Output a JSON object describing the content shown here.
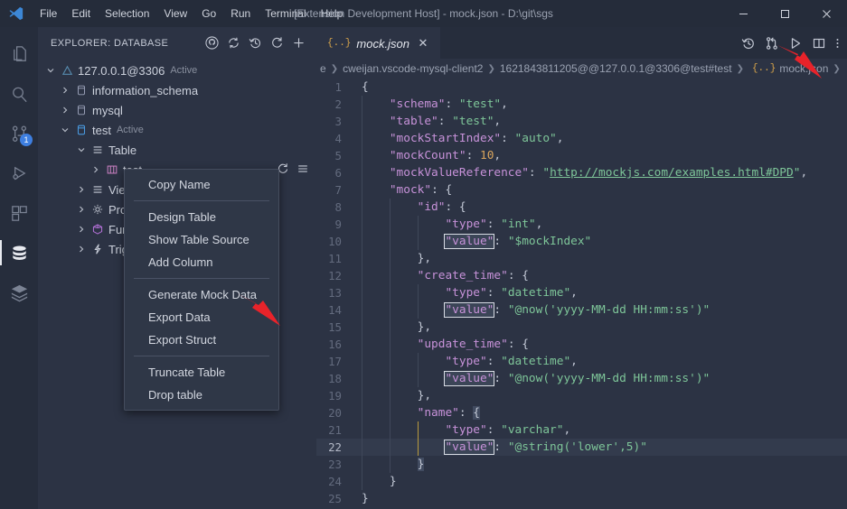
{
  "window": {
    "title": "[Extension Development Host] - mock.json - D:\\git\\sgs",
    "minimize": "—",
    "maximize": "☐",
    "close": "✕"
  },
  "menu": {
    "items": [
      {
        "label": "File"
      },
      {
        "label": "Edit"
      },
      {
        "label": "Selection"
      },
      {
        "label": "View"
      },
      {
        "label": "Go"
      },
      {
        "label": "Run"
      },
      {
        "label": "Terminal"
      },
      {
        "label": "Help"
      }
    ]
  },
  "activitybar": {
    "items": [
      {
        "name": "explorer-files-icon",
        "badge": ""
      },
      {
        "name": "search-icon",
        "badge": ""
      },
      {
        "name": "source-control-icon",
        "badge": "1"
      },
      {
        "name": "run-debug-icon",
        "badge": ""
      },
      {
        "name": "extensions-icon",
        "badge": ""
      },
      {
        "name": "database-icon",
        "badge": ""
      },
      {
        "name": "database-stack-icon",
        "badge": ""
      }
    ]
  },
  "sidebar": {
    "title": "EXPLORER: DATABASE",
    "actions": [
      {
        "name": "github-icon"
      },
      {
        "name": "sync-icon"
      },
      {
        "name": "history-icon"
      },
      {
        "name": "refresh-icon"
      },
      {
        "name": "add-icon"
      }
    ],
    "tree": [
      {
        "label": "127.0.0.1@3306",
        "sub": "Active",
        "icon": "server-icon",
        "indent": 0,
        "expanded": true
      },
      {
        "label": "information_schema",
        "sub": "",
        "icon": "database-icon",
        "indent": 1,
        "expanded": false
      },
      {
        "label": "mysql",
        "sub": "",
        "icon": "database-icon",
        "indent": 1,
        "expanded": false
      },
      {
        "label": "test",
        "sub": "Active",
        "icon": "database-active-icon",
        "indent": 1,
        "expanded": true
      },
      {
        "label": "Table",
        "sub": "",
        "icon": "table-group-icon",
        "indent": 2,
        "expanded": true
      },
      {
        "label": "test",
        "sub": "",
        "icon": "table-icon",
        "indent": 3,
        "expanded": false
      },
      {
        "label": "View",
        "sub": "",
        "icon": "view-group-icon",
        "indent": 2,
        "expanded": false
      },
      {
        "label": "Proc",
        "sub": "",
        "icon": "procedure-icon",
        "indent": 2,
        "expanded": false
      },
      {
        "label": "Func",
        "sub": "",
        "icon": "function-icon",
        "indent": 2,
        "expanded": false
      },
      {
        "label": "Trigg",
        "sub": "",
        "icon": "trigger-icon",
        "indent": 2,
        "expanded": false
      }
    ],
    "row_actions": [
      {
        "name": "refresh-icon"
      },
      {
        "name": "menu-icon"
      }
    ]
  },
  "context_menu": {
    "items": [
      {
        "label": "Copy Name",
        "type": "item"
      },
      {
        "label": "",
        "type": "separator"
      },
      {
        "label": "Design Table",
        "type": "item"
      },
      {
        "label": "Show Table Source",
        "type": "item"
      },
      {
        "label": "Add Column",
        "type": "item"
      },
      {
        "label": "",
        "type": "separator"
      },
      {
        "label": "Generate Mock Data",
        "type": "item"
      },
      {
        "label": "Export Data",
        "type": "item"
      },
      {
        "label": "Export Struct",
        "type": "item"
      },
      {
        "label": "",
        "type": "separator"
      },
      {
        "label": "Truncate Table",
        "type": "item"
      },
      {
        "label": "Drop table",
        "type": "item"
      }
    ]
  },
  "editor": {
    "tab": {
      "label": "mock.json",
      "glyph": "{..}",
      "close": "✕"
    },
    "actions": [
      {
        "name": "timeline-history-icon"
      },
      {
        "name": "compare-changes-icon"
      },
      {
        "name": "run-play-icon"
      },
      {
        "name": "split-editor-icon"
      },
      {
        "name": "more-actions-icon"
      }
    ],
    "breadcrumb": [
      "e",
      "cweijan.vscode-mysql-client2",
      "1621843811205@@127.0.0.1@3306@test#test",
      "mock.json",
      ""
    ],
    "active_line": 22,
    "lines": [
      {
        "n": 1,
        "tokens": [
          {
            "t": "p",
            "v": "{"
          }
        ]
      },
      {
        "n": 2,
        "tokens": [
          {
            "t": "sp",
            "v": "    "
          },
          {
            "t": "k",
            "v": "\"schema\""
          },
          {
            "t": "p",
            "v": ": "
          },
          {
            "t": "s",
            "v": "\"test\""
          },
          {
            "t": "p",
            "v": ","
          }
        ]
      },
      {
        "n": 3,
        "tokens": [
          {
            "t": "sp",
            "v": "    "
          },
          {
            "t": "k",
            "v": "\"table\""
          },
          {
            "t": "p",
            "v": ": "
          },
          {
            "t": "s",
            "v": "\"test\""
          },
          {
            "t": "p",
            "v": ","
          }
        ]
      },
      {
        "n": 4,
        "tokens": [
          {
            "t": "sp",
            "v": "    "
          },
          {
            "t": "k",
            "v": "\"mockStartIndex\""
          },
          {
            "t": "p",
            "v": ": "
          },
          {
            "t": "s",
            "v": "\"auto\""
          },
          {
            "t": "p",
            "v": ","
          }
        ]
      },
      {
        "n": 5,
        "tokens": [
          {
            "t": "sp",
            "v": "    "
          },
          {
            "t": "k",
            "v": "\"mockCount\""
          },
          {
            "t": "p",
            "v": ": "
          },
          {
            "t": "n",
            "v": "10"
          },
          {
            "t": "p",
            "v": ","
          }
        ]
      },
      {
        "n": 6,
        "tokens": [
          {
            "t": "sp",
            "v": "    "
          },
          {
            "t": "k",
            "v": "\"mockValueReference\""
          },
          {
            "t": "p",
            "v": ": "
          },
          {
            "t": "s",
            "v": "\""
          },
          {
            "t": "url",
            "v": "http://mockjs.com/examples.html#DPD"
          },
          {
            "t": "s",
            "v": "\""
          },
          {
            "t": "p",
            "v": ","
          }
        ]
      },
      {
        "n": 7,
        "tokens": [
          {
            "t": "sp",
            "v": "    "
          },
          {
            "t": "k",
            "v": "\"mock\""
          },
          {
            "t": "p",
            "v": ": {"
          }
        ]
      },
      {
        "n": 8,
        "tokens": [
          {
            "t": "sp",
            "v": "        "
          },
          {
            "t": "k",
            "v": "\"id\""
          },
          {
            "t": "p",
            "v": ": {"
          }
        ]
      },
      {
        "n": 9,
        "tokens": [
          {
            "t": "sp",
            "v": "            "
          },
          {
            "t": "k",
            "v": "\"type\""
          },
          {
            "t": "p",
            "v": ": "
          },
          {
            "t": "s",
            "v": "\"int\""
          },
          {
            "t": "p",
            "v": ","
          }
        ]
      },
      {
        "n": 10,
        "tokens": [
          {
            "t": "sp",
            "v": "            "
          },
          {
            "t": "km",
            "v": "\"value\""
          },
          {
            "t": "p",
            "v": ": "
          },
          {
            "t": "s",
            "v": "\"$mockIndex\""
          }
        ]
      },
      {
        "n": 11,
        "tokens": [
          {
            "t": "sp",
            "v": "        "
          },
          {
            "t": "p",
            "v": "},"
          }
        ]
      },
      {
        "n": 12,
        "tokens": [
          {
            "t": "sp",
            "v": "        "
          },
          {
            "t": "k",
            "v": "\"create_time\""
          },
          {
            "t": "p",
            "v": ": {"
          }
        ]
      },
      {
        "n": 13,
        "tokens": [
          {
            "t": "sp",
            "v": "            "
          },
          {
            "t": "k",
            "v": "\"type\""
          },
          {
            "t": "p",
            "v": ": "
          },
          {
            "t": "s",
            "v": "\"datetime\""
          },
          {
            "t": "p",
            "v": ","
          }
        ]
      },
      {
        "n": 14,
        "tokens": [
          {
            "t": "sp",
            "v": "            "
          },
          {
            "t": "km",
            "v": "\"value\""
          },
          {
            "t": "p",
            "v": ": "
          },
          {
            "t": "s",
            "v": "\"@now('yyyy-MM-dd HH:mm:ss')\""
          }
        ]
      },
      {
        "n": 15,
        "tokens": [
          {
            "t": "sp",
            "v": "        "
          },
          {
            "t": "p",
            "v": "},"
          }
        ]
      },
      {
        "n": 16,
        "tokens": [
          {
            "t": "sp",
            "v": "        "
          },
          {
            "t": "k",
            "v": "\"update_time\""
          },
          {
            "t": "p",
            "v": ": {"
          }
        ]
      },
      {
        "n": 17,
        "tokens": [
          {
            "t": "sp",
            "v": "            "
          },
          {
            "t": "k",
            "v": "\"type\""
          },
          {
            "t": "p",
            "v": ": "
          },
          {
            "t": "s",
            "v": "\"datetime\""
          },
          {
            "t": "p",
            "v": ","
          }
        ]
      },
      {
        "n": 18,
        "tokens": [
          {
            "t": "sp",
            "v": "            "
          },
          {
            "t": "km",
            "v": "\"value\""
          },
          {
            "t": "p",
            "v": ": "
          },
          {
            "t": "s",
            "v": "\"@now('yyyy-MM-dd HH:mm:ss')\""
          }
        ]
      },
      {
        "n": 19,
        "tokens": [
          {
            "t": "sp",
            "v": "        "
          },
          {
            "t": "p",
            "v": "},"
          }
        ]
      },
      {
        "n": 20,
        "tokens": [
          {
            "t": "sp",
            "v": "        "
          },
          {
            "t": "k",
            "v": "\"name\""
          },
          {
            "t": "p",
            "v": ": "
          },
          {
            "t": "br",
            "v": "{"
          }
        ]
      },
      {
        "n": 21,
        "tokens": [
          {
            "t": "sp",
            "v": "            "
          },
          {
            "t": "k",
            "v": "\"type\""
          },
          {
            "t": "p",
            "v": ": "
          },
          {
            "t": "s",
            "v": "\"varchar\""
          },
          {
            "t": "p",
            "v": ","
          }
        ]
      },
      {
        "n": 22,
        "tokens": [
          {
            "t": "sp",
            "v": "            "
          },
          {
            "t": "km",
            "v": "\"value\""
          },
          {
            "t": "p",
            "v": ": "
          },
          {
            "t": "s",
            "v": "\"@string('lower',5)\""
          }
        ]
      },
      {
        "n": 23,
        "tokens": [
          {
            "t": "sp",
            "v": "        "
          },
          {
            "t": "br",
            "v": "}"
          }
        ]
      },
      {
        "n": 24,
        "tokens": [
          {
            "t": "sp",
            "v": "    "
          },
          {
            "t": "p",
            "v": "}"
          }
        ]
      },
      {
        "n": 25,
        "tokens": [
          {
            "t": "p",
            "v": "}"
          }
        ]
      }
    ]
  },
  "annotations": {
    "arrow_color": "#e8232a",
    "arrows": [
      {
        "name": "arrow-generate-mock-data"
      },
      {
        "name": "arrow-run-button"
      }
    ]
  }
}
